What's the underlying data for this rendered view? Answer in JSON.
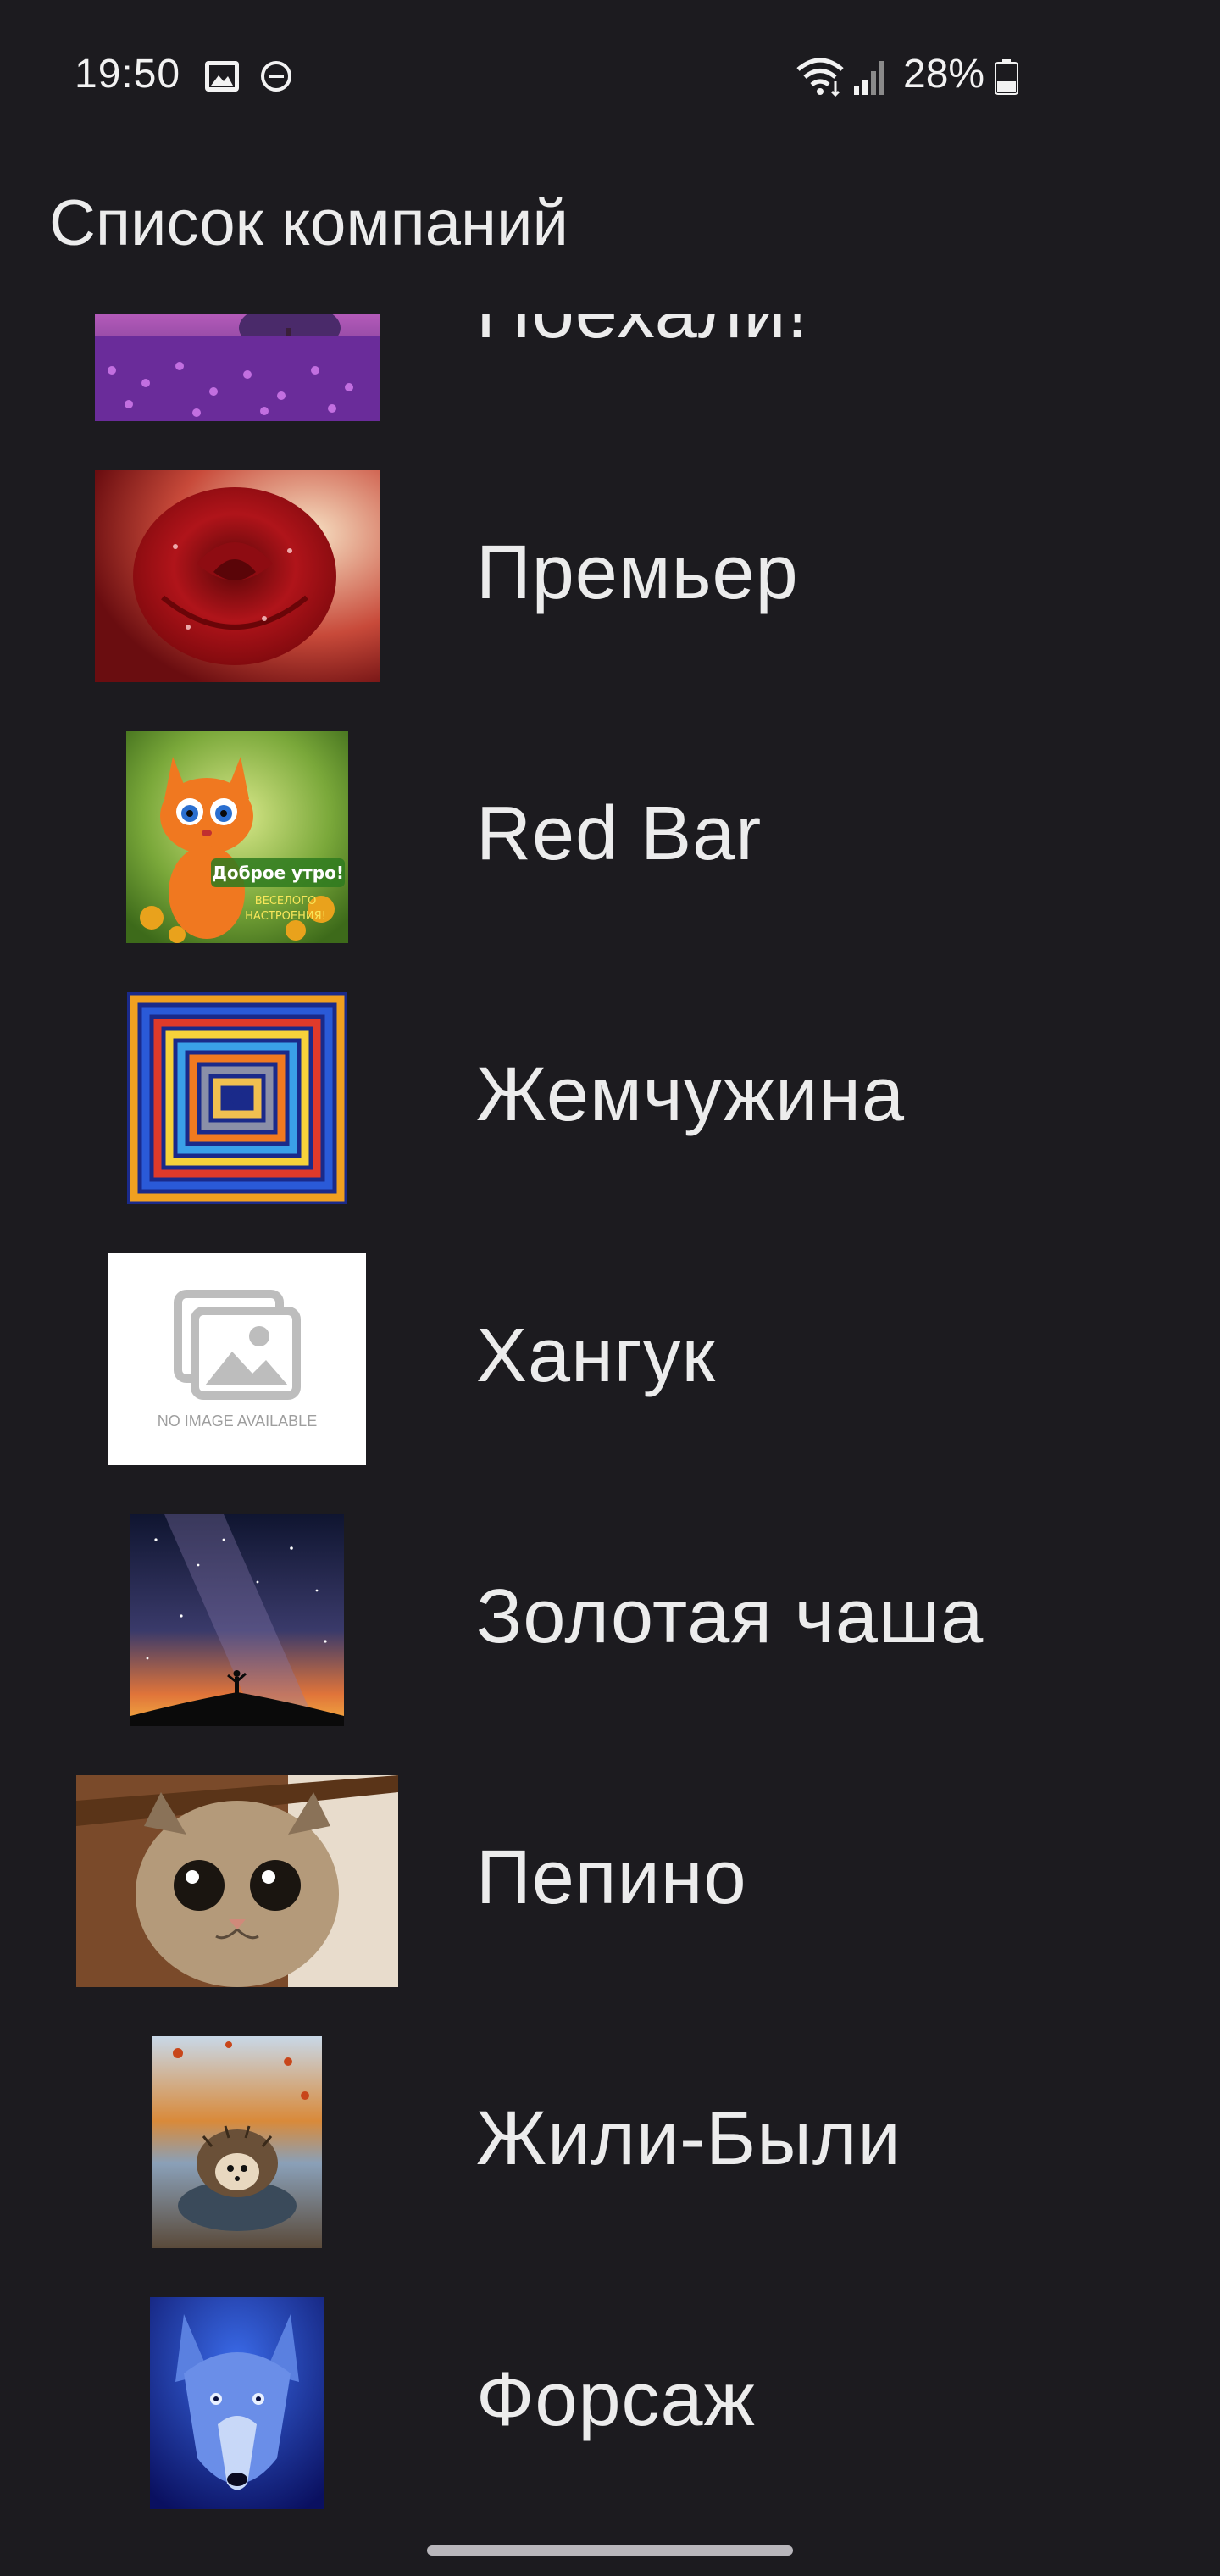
{
  "status_bar": {
    "time": "19:50",
    "battery_percent": "28%",
    "icons": [
      "gallery-icon",
      "dnd-icon",
      "wifi-icon",
      "signal-icon",
      "battery-icon"
    ]
  },
  "app_bar": {
    "title": "Список компаний"
  },
  "companies": [
    {
      "name": "Поехали!",
      "image": "lavender-field"
    },
    {
      "name": "Премьер",
      "image": "red-rose"
    },
    {
      "name": "Red Bar",
      "image": "cartoon-kitten-card"
    },
    {
      "name": "Жемчужина",
      "image": "psychedelic-spiral"
    },
    {
      "name": "Хангук",
      "image": "no-image-placeholder",
      "placeholder_text": "NO IMAGE AVAILABLE"
    },
    {
      "name": "Золотая чаша",
      "image": "milky-way-night"
    },
    {
      "name": "Пепино",
      "image": "kitten-photo"
    },
    {
      "name": "Жили-Были",
      "image": "hedgehog-autumn"
    },
    {
      "name": "Форсаж",
      "image": "blue-wolf"
    }
  ],
  "card_texts": {
    "greeting": "Доброе утро!",
    "wish_line1": "ВЕСЕЛОГО",
    "wish_line2": "НАСТРОЕНИЯ!"
  },
  "colors": {
    "background": "#1c1b1f",
    "text": "#ececec"
  }
}
